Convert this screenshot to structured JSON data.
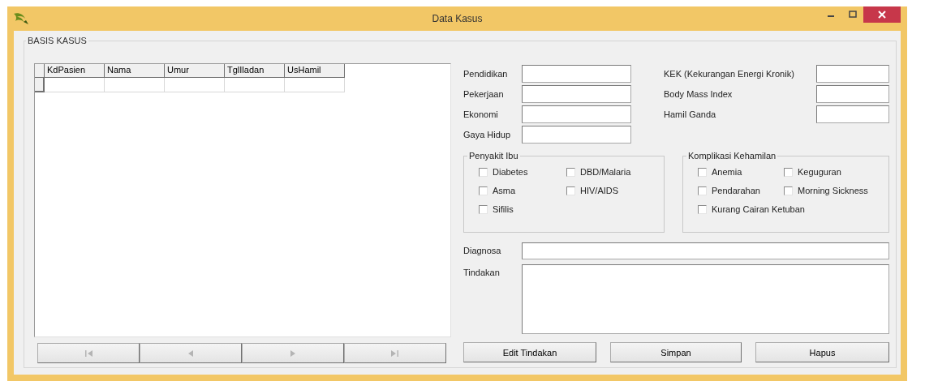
{
  "window": {
    "title": "Data Kasus"
  },
  "basis": {
    "title": "BASIS KASUS"
  },
  "table": {
    "columns": [
      "KdPasien",
      "Nama",
      "Umur",
      "TglIladan",
      "UsHamil"
    ]
  },
  "navigator": [
    {
      "kind": "first",
      "disabled": true
    },
    {
      "kind": "prev",
      "disabled": true
    },
    {
      "kind": "next",
      "disabled": true
    },
    {
      "kind": "last",
      "disabled": true
    }
  ],
  "fields_left": [
    {
      "label": "Pendidikan"
    },
    {
      "label": "Pekerjaan"
    },
    {
      "label": "Ekonomi"
    },
    {
      "label": "Gaya Hidup"
    }
  ],
  "fields_right": [
    {
      "label": "KEK (Kekurangan Energi Kronik)"
    },
    {
      "label": "Body Mass Index"
    },
    {
      "label": "Hamil Ganda"
    }
  ],
  "penyakit_ibu": {
    "title": "Penyakit Ibu",
    "options": [
      {
        "label": "Diabetes",
        "checked": false
      },
      {
        "label": "DBD/Malaria",
        "checked": false
      },
      {
        "label": "Asma",
        "checked": false
      },
      {
        "label": "HIV/AIDS",
        "checked": false
      },
      {
        "label": "Sifilis",
        "checked": false
      }
    ]
  },
  "komplikasi_kehamilan": {
    "title": "Komplikasi Kehamilan",
    "options": [
      {
        "label": "Anemia",
        "checked": false
      },
      {
        "label": "Keguguran",
        "checked": false
      },
      {
        "label": "Pendarahan",
        "checked": false
      },
      {
        "label": "Morning Sickness",
        "checked": false
      },
      {
        "label": "Kurang Cairan Ketuban",
        "checked": false
      }
    ]
  },
  "diagnosa": {
    "label": "Diagnosa"
  },
  "tindakan": {
    "label": "Tindakan"
  },
  "buttons": [
    "Edit Tindakan",
    "Simpan",
    "Hapus"
  ]
}
